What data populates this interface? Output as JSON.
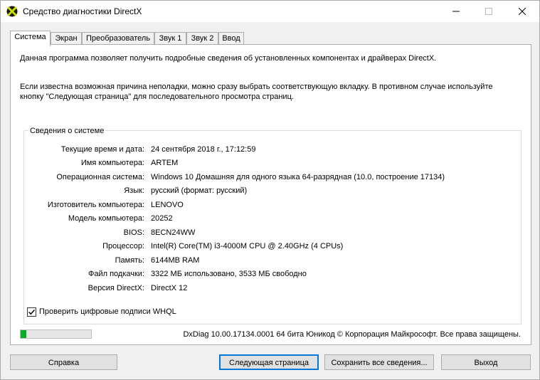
{
  "window": {
    "title": "Средство диагностики DirectX",
    "app_icon": "directx-icon"
  },
  "tabs": [
    {
      "label": "Система",
      "active": true
    },
    {
      "label": "Экран",
      "active": false
    },
    {
      "label": "Преобразователь",
      "active": false
    },
    {
      "label": "Звук 1",
      "active": false
    },
    {
      "label": "Звук 2",
      "active": false
    },
    {
      "label": "Ввод",
      "active": false
    }
  ],
  "intro": {
    "line1": "Данная программа позволяет получить подробные сведения об установленных компонентах и драйверах DirectX.",
    "line2": "Если известна возможная причина неполадки, можно сразу выбрать соответствующую вкладку. В противном случае используйте кнопку \"Следующая страница\" для последовательного просмотра страниц."
  },
  "system_info": {
    "title": "Сведения о системе",
    "rows": [
      {
        "label": "Текущие время и дата:",
        "value": "24 сентября 2018 г., 17:12:59"
      },
      {
        "label": "Имя компьютера:",
        "value": "ARTEM"
      },
      {
        "label": "Операционная система:",
        "value": "Windows 10 Домашняя для одного языка 64-разрядная (10.0, построение 17134)"
      },
      {
        "label": "Язык:",
        "value": "русский (формат: русский)"
      },
      {
        "label": "Изготовитель компьютера:",
        "value": "LENOVO"
      },
      {
        "label": "Модель компьютера:",
        "value": "20252"
      },
      {
        "label": "BIOS:",
        "value": "8ECN24WW"
      },
      {
        "label": "Процессор:",
        "value": "Intel(R) Core(TM) i3-4000M CPU @ 2.40GHz (4 CPUs)"
      },
      {
        "label": "Память:",
        "value": "6144MB RAM"
      },
      {
        "label": "Файл подкачки:",
        "value": "3322 МБ использовано, 3533 МБ свободно"
      },
      {
        "label": "Версия DirectX:",
        "value": "DirectX 12"
      }
    ]
  },
  "whql_checkbox": {
    "label": "Проверить цифровые подписи WHQL",
    "checked": true
  },
  "progress": {
    "fraction": 0.08,
    "color": "#06b025"
  },
  "footer_text": "DxDiag 10.00.17134.0001 64 бита Юникод © Корпорация Майкрософт. Все права защищены.",
  "buttons": {
    "help": "Справка",
    "next_page": "Следующая страница",
    "save_all": "Сохранить все сведения...",
    "exit": "Выход"
  }
}
